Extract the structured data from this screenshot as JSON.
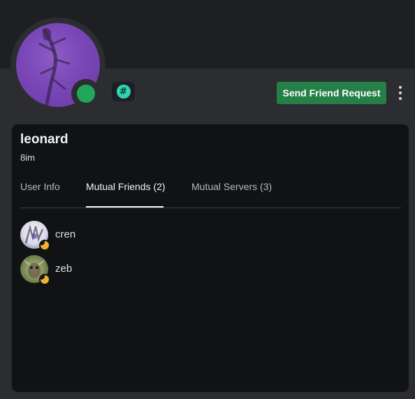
{
  "profile": {
    "username": "leonard",
    "tag": "8im",
    "status": "online",
    "avatar_icon": "lizard-avatar",
    "badge_icon": "hash-badge-icon",
    "badge_glyph": "#"
  },
  "actions": {
    "send_friend_request_label": "Send Friend Request",
    "more_icon": "vertical-ellipsis-icon"
  },
  "tabs": [
    {
      "label": "User Info",
      "active": false
    },
    {
      "label": "Mutual Friends (2)",
      "active": true
    },
    {
      "label": "Mutual Servers (3)",
      "active": false
    }
  ],
  "mutual_friends": [
    {
      "name": "cren",
      "status": "idle",
      "status_icon": "moon-icon"
    },
    {
      "name": "zeb",
      "status": "idle",
      "status_icon": "moon-icon"
    }
  ],
  "colors": {
    "background": "#2b2d31",
    "banner": "#1e1f22",
    "card": "#111214",
    "online": "#23a55a",
    "idle": "#f0b232",
    "button": "#248046",
    "avatar_purple": "#7a47b7",
    "badge": "#2dd4b4"
  }
}
